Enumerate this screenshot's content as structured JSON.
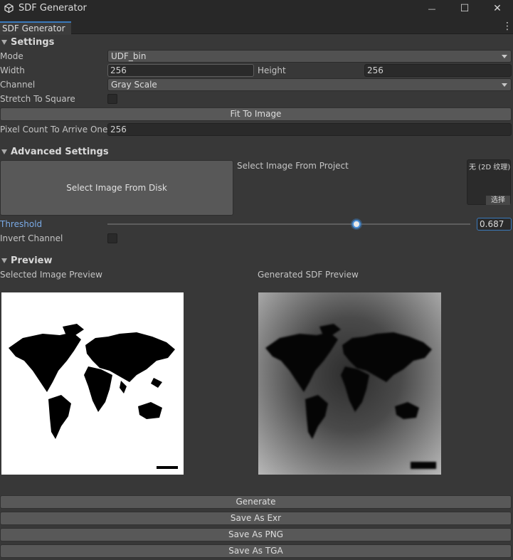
{
  "window": {
    "title": "SDF Generator",
    "controls": {
      "minimize": "—",
      "maximize": "☐",
      "close": "✕"
    }
  },
  "tab": {
    "label": "SDF Generator",
    "menu": "⋮"
  },
  "settings": {
    "header": "Settings",
    "mode_label": "Mode",
    "mode_value": "UDF_bin",
    "width_label": "Width",
    "width_value": "256",
    "height_label": "Height",
    "height_value": "256",
    "channel_label": "Channel",
    "channel_value": "Gray Scale",
    "stretch_label": "Stretch To Square",
    "stretch_checked": false,
    "fit_button": "Fit To Image",
    "pixel_count_label": "Pixel Count To Arrive One",
    "pixel_count_value": "256"
  },
  "advanced": {
    "header": "Advanced Settings",
    "select_disk_button": "Select Image From Disk",
    "select_project_label": "Select Image From Project",
    "object_field_value": "无 (2D 纹理)",
    "object_field_select": "选择",
    "threshold_label": "Threshold",
    "threshold_value": "0.687",
    "threshold_fraction": 0.687,
    "invert_label": "Invert Channel",
    "invert_checked": false
  },
  "preview": {
    "header": "Preview",
    "selected_label": "Selected Image Preview",
    "generated_label": "Generated SDF Preview"
  },
  "actions": {
    "generate": "Generate",
    "save_exr": "Save As Exr",
    "save_png": "Save As PNG",
    "save_tga": "Save As TGA"
  },
  "colors": {
    "background": "#383838",
    "accent": "#3a79bb",
    "threshold_label": "#7aaae6"
  }
}
